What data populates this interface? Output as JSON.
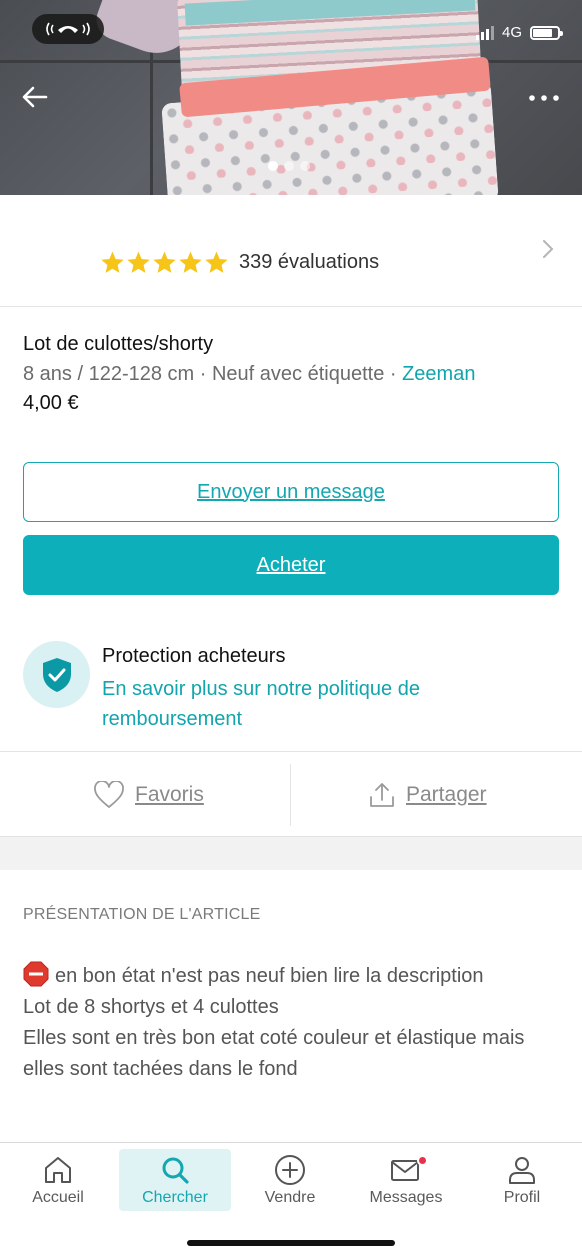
{
  "status_bar": {
    "network": "4G",
    "call_icon": "phone-call-icon",
    "battery_level": 0.8,
    "signal_bars_active": 3
  },
  "hero": {
    "image_count": 3,
    "active_image_index": 0,
    "back_icon": "arrow-left-icon",
    "more_icon": "more-horizontal-icon"
  },
  "seller": {
    "rating_stars": 5,
    "reviews_label": "339 évaluations",
    "star_color": "#f7c518"
  },
  "item": {
    "title": "Lot de culottes/shorty",
    "meta_prefix": "8 ans / 122-128 cm · Neuf avec étiquette · ",
    "brand": "Zeeman",
    "price": "4,00 €"
  },
  "buttons": {
    "message": "Envoyer un message",
    "buy": "Acheter"
  },
  "protection": {
    "title": "Protection acheteurs",
    "link": "En savoir plus sur notre politique de remboursement"
  },
  "actions": {
    "favorites": "Favoris",
    "share": "Partager"
  },
  "description": {
    "header": "PRÉSENTATION DE L'ARTICLE",
    "line1": "en bon état n'est pas neuf bien lire la description",
    "line2": "Lot de 8 shortys et 4 culottes",
    "line3": "Elles sont en très bon etat coté couleur et élastique mais elles sont tachées dans le fond"
  },
  "nav": {
    "items": [
      {
        "label": "Accueil",
        "icon": "home-icon"
      },
      {
        "label": "Chercher",
        "icon": "search-icon",
        "active": true
      },
      {
        "label": "Vendre",
        "icon": "plus-circle-icon"
      },
      {
        "label": "Messages",
        "icon": "mail-icon",
        "badge": true
      },
      {
        "label": "Profil",
        "icon": "user-icon"
      }
    ]
  },
  "colors": {
    "accent": "#0db0ba",
    "link": "#12a5ad",
    "badge": "#e8314a"
  }
}
